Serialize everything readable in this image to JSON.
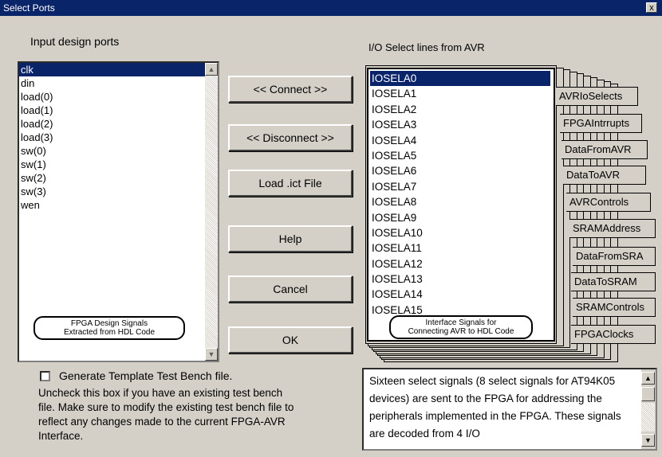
{
  "window": {
    "title": "Select Ports",
    "close_label": "x"
  },
  "input_ports": {
    "header": "Input design ports",
    "items": [
      "clk",
      "din",
      "load(0)",
      "load(1)",
      "load(2)",
      "load(3)",
      "sw(0)",
      "sw(1)",
      "sw(2)",
      "sw(3)",
      "wen"
    ],
    "selected_item": "clk",
    "caption_line1": "FPGA Design Signals",
    "caption_line2": "Extracted from HDL Code"
  },
  "buttons": {
    "connect": "<< Connect >>",
    "disconnect": "<< Disconnect >>",
    "load_ict": "Load .ict File",
    "help": "Help",
    "cancel": "Cancel",
    "ok": "OK"
  },
  "io_select": {
    "header": "I/O Select lines from AVR",
    "items": [
      "IOSELA0",
      "IOSELA1",
      "IOSELA2",
      "IOSELA3",
      "IOSELA4",
      "IOSELA5",
      "IOSELA6",
      "IOSELA7",
      "IOSELA8",
      "IOSELA9",
      "IOSELA10",
      "IOSELA11",
      "IOSELA12",
      "IOSELA13",
      "IOSELA14",
      "IOSELA15"
    ],
    "selected_item": "IOSELA0",
    "caption_line1": "Interface Signals for",
    "caption_line2": "Connecting AVR to HDL Code"
  },
  "tabs": [
    "AVRIoSelects",
    "FPGAIntrrupts",
    "DataFromAVR",
    "DataToAVR",
    "AVRControls",
    "SRAMAddress",
    "DataFromSRA",
    "DataToSRAM",
    "SRAMControls",
    "FPGAClocks"
  ],
  "testbench": {
    "checkbox_label": "Generate Template Test Bench file.",
    "checked": false,
    "note": "Uncheck this box if you have an existing test bench file.  Make sure to  modify the  existing test bench file to reflect any changes made to the current FPGA-AVR Interface."
  },
  "description": {
    "text": "Sixteen select signals (8 select signals for AT94K05 devices) are sent to the FPGA for addressing the peripherals implemented in the FPGA. These signals are decoded from 4 I/O"
  }
}
